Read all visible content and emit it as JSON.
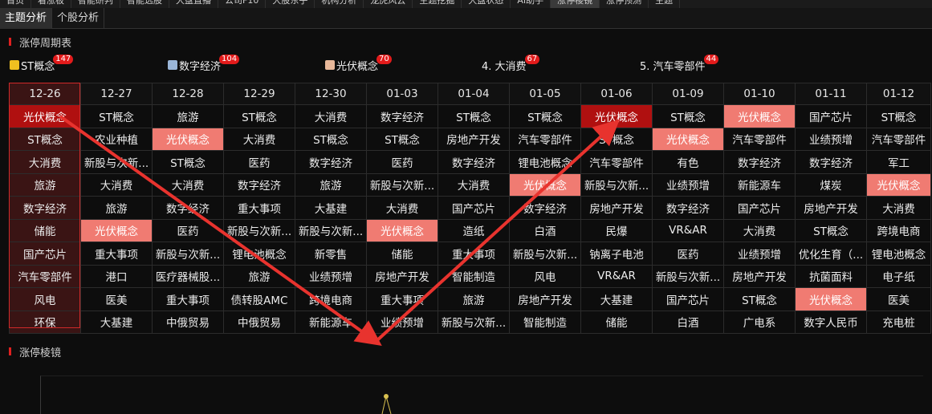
{
  "top_nav": [
    "首页",
    "看涨板",
    "智能研判",
    "智能选股",
    "大盘直播",
    "公司F10",
    "大股东子",
    "机构分析",
    "龙虎风云",
    "主题挖掘",
    "大盘状态",
    "AI助手",
    "涨停棱镜",
    "涨停预测",
    "主题"
  ],
  "subtabs": [
    "主题分析",
    "个股分析"
  ],
  "section1_title": "涨停周期表",
  "section2_title": "涨停棱镜",
  "concepts": [
    {
      "label": "ST概念",
      "count": "147",
      "icon_color": "#f0c020"
    },
    {
      "label": "数字经济",
      "count": "104",
      "icon_color": "#9ab6d8"
    },
    {
      "label": "光伏概念",
      "count": "70",
      "icon_color": "#e8b89a"
    },
    {
      "label": "4. 大消费",
      "count": "67",
      "icon_color": ""
    },
    {
      "label": "5. 汽车零部件",
      "count": "44",
      "icon_color": ""
    }
  ],
  "dates": [
    "12-26",
    "12-27",
    "12-28",
    "12-29",
    "12-30",
    "01-03",
    "01-04",
    "01-05",
    "01-06",
    "01-09",
    "01-10",
    "01-11",
    "01-12"
  ],
  "rows": [
    [
      "光伏概念",
      "ST概念",
      "旅游",
      "ST概念",
      "大消费",
      "数字经济",
      "ST概念",
      "ST概念",
      "光伏概念",
      "ST概念",
      "光伏概念",
      "国产芯片",
      "ST概念"
    ],
    [
      "ST概念",
      "农业种植",
      "光伏概念",
      "大消费",
      "ST概念",
      "ST概念",
      "房地产开发",
      "汽车零部件",
      "ST概念",
      "光伏概念",
      "汽车零部件",
      "业绩预增",
      "汽车零部件"
    ],
    [
      "大消费",
      "新股与次新...",
      "ST概念",
      "医药",
      "数字经济",
      "医药",
      "数字经济",
      "锂电池概念",
      "汽车零部件",
      "有色",
      "数字经济",
      "数字经济",
      "军工"
    ],
    [
      "旅游",
      "大消费",
      "大消费",
      "数字经济",
      "旅游",
      "新股与次新...",
      "大消费",
      "光伏概念",
      "新股与次新...",
      "业绩预增",
      "新能源车",
      "煤炭",
      "光伏概念"
    ],
    [
      "数字经济",
      "旅游",
      "数字经济",
      "重大事项",
      "大基建",
      "大消费",
      "国产芯片",
      "数字经济",
      "房地产开发",
      "数字经济",
      "国产芯片",
      "房地产开发",
      "大消费"
    ],
    [
      "储能",
      "光伏概念",
      "医药",
      "新股与次新...",
      "新股与次新...",
      "光伏概念",
      "造纸",
      "白酒",
      "民爆",
      "VR&AR",
      "大消费",
      "ST概念",
      "跨境电商"
    ],
    [
      "国产芯片",
      "重大事项",
      "新股与次新...",
      "锂电池概念",
      "新零售",
      "储能",
      "重大事项",
      "新股与次新...",
      "钠离子电池",
      "医药",
      "业绩预增",
      "优化生育（...",
      "锂电池概念"
    ],
    [
      "汽车零部件",
      "港口",
      "医疗器械股...",
      "旅游",
      "业绩预增",
      "房地产开发",
      "智能制造",
      "风电",
      "VR&AR",
      "新股与次新...",
      "房地产开发",
      "抗菌面料",
      "电子纸"
    ],
    [
      "风电",
      "医美",
      "重大事项",
      "债转股AMC",
      "跨境电商",
      "重大事项",
      "旅游",
      "房地产开发",
      "大基建",
      "国产芯片",
      "ST概念",
      "光伏概念",
      "医美"
    ],
    [
      "环保",
      "大基建",
      "中俄贸易",
      "中俄贸易",
      "新能源车",
      "业绩预增",
      "新股与次新...",
      "智能制造",
      "储能",
      "白酒",
      "广电系",
      "数字人民币",
      "充电桩"
    ]
  ],
  "highlights_dark": [
    [
      0,
      0
    ],
    [
      0,
      8
    ]
  ],
  "highlights_light": [
    [
      0,
      10
    ],
    [
      1,
      2
    ],
    [
      1,
      9
    ],
    [
      3,
      7
    ],
    [
      3,
      12
    ],
    [
      5,
      1
    ],
    [
      5,
      5
    ],
    [
      8,
      11
    ]
  ],
  "colors": {
    "accent_red": "#e02020",
    "dark_red": "#b01010",
    "light_red": "#f07b72",
    "arrow": "#e8332e"
  }
}
